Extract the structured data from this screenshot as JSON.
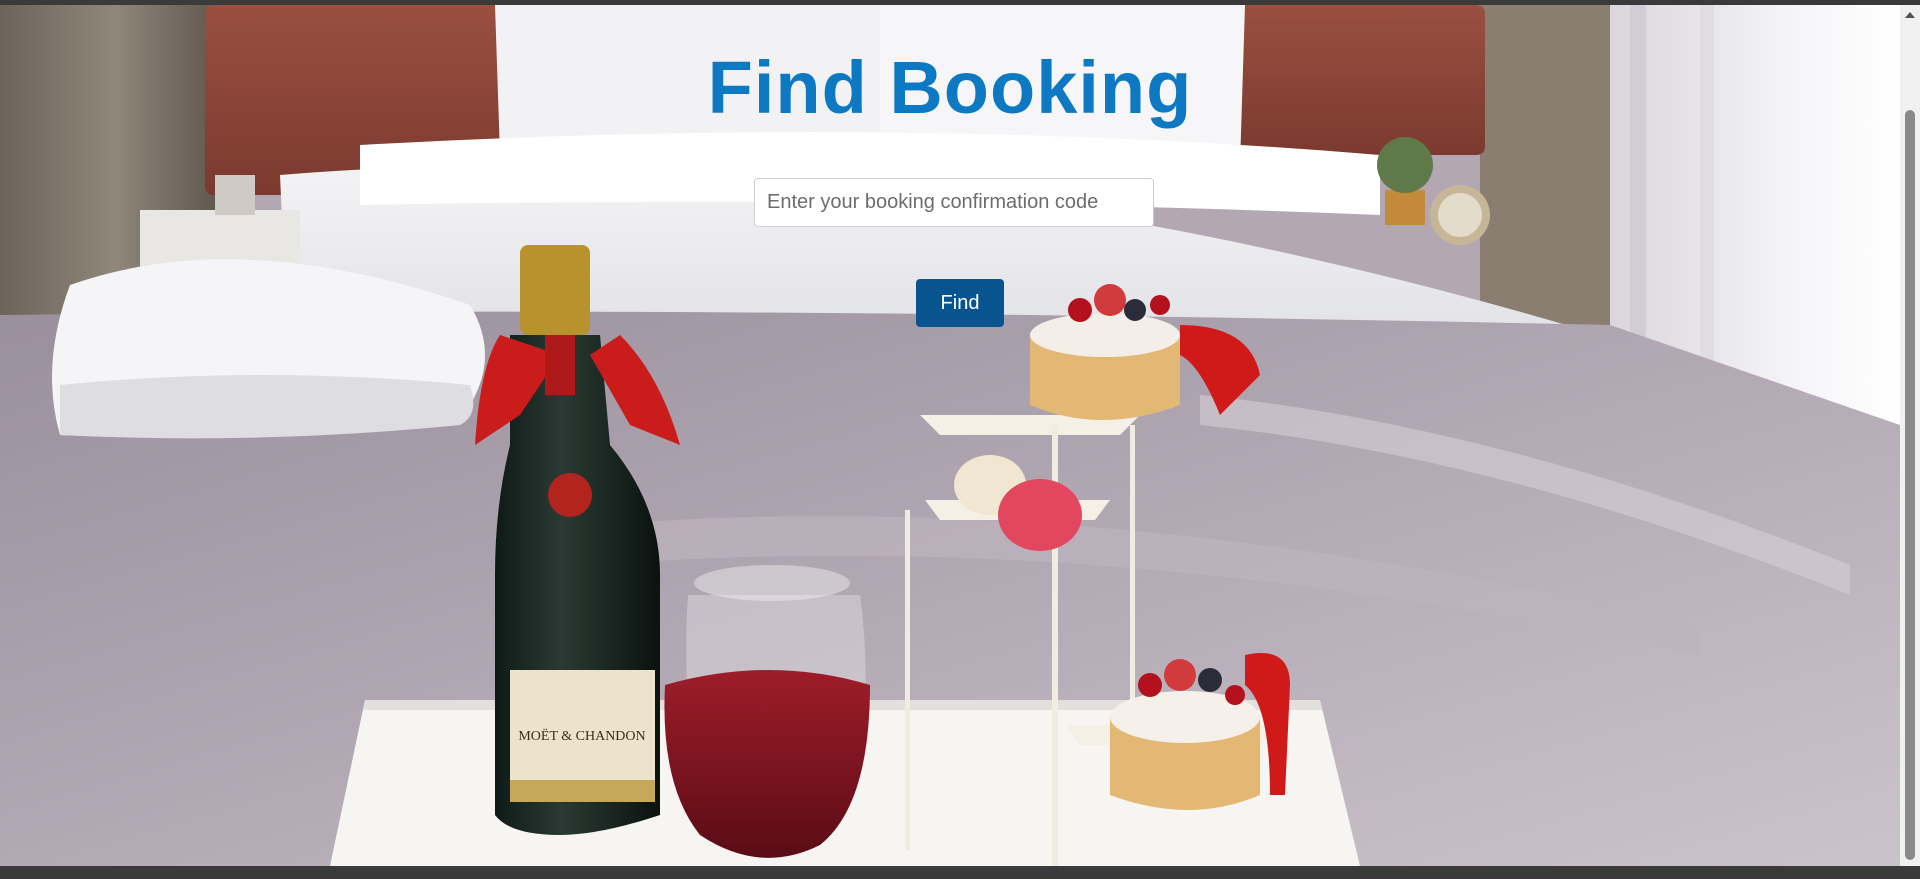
{
  "page": {
    "title": "Find Booking"
  },
  "search": {
    "placeholder": "Enter your booking confirmation code",
    "value": ""
  },
  "actions": {
    "find_label": "Find"
  },
  "background": {
    "image_icon": "hotel-room-photo",
    "label_text": "MOËT & CHANDON"
  },
  "colors": {
    "title": "#0e79c3",
    "button": "#08548e",
    "button_text": "#ffffff"
  }
}
